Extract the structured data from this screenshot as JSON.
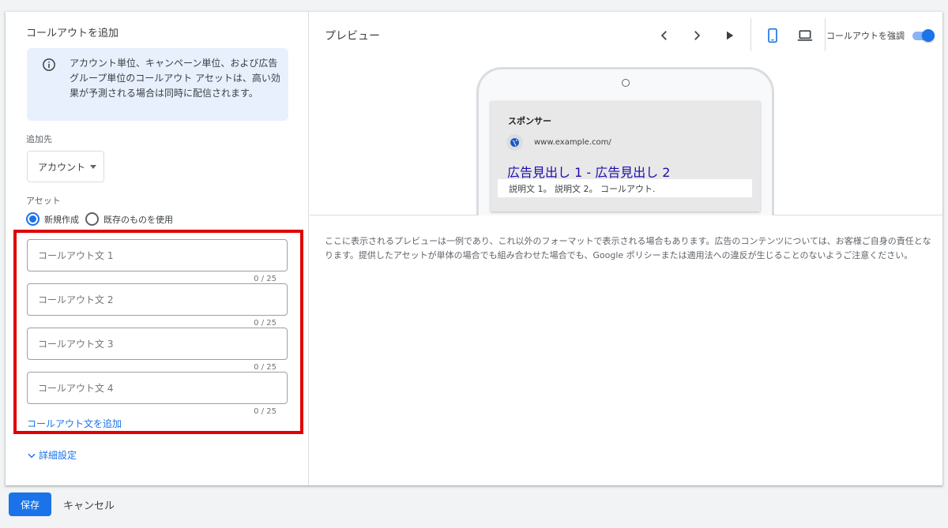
{
  "panel": {
    "title": "コールアウトを追加",
    "info_text": "アカウント単位、キャンペーン単位、および広告グループ単位のコールアウト アセットは、高い効果が予測される場合は同時に配信されます。",
    "add_to_label": "追加先",
    "add_to_value": "アカウント",
    "asset_label": "アセット",
    "radio_new": "新規作成",
    "radio_existing": "既存のものを使用",
    "radio_selected": "新規作成",
    "fields": [
      {
        "placeholder": "コールアウト文 1",
        "value": "",
        "counter": "0 / 25"
      },
      {
        "placeholder": "コールアウト文 2",
        "value": "",
        "counter": "0 / 25"
      },
      {
        "placeholder": "コールアウト文 3",
        "value": "",
        "counter": "0 / 25"
      },
      {
        "placeholder": "コールアウト文 4",
        "value": "",
        "counter": "0 / 25"
      }
    ],
    "add_callout_link": "コールアウト文を追加",
    "advanced_settings": "詳細設定"
  },
  "preview": {
    "title": "プレビュー",
    "toolbar": {
      "prev_icon": "chevron-left-icon",
      "next_icon": "chevron-right-icon",
      "play_icon": "play-icon",
      "mobile_icon": "smartphone-icon",
      "desktop_icon": "laptop-icon",
      "toggle_label": "コールアウトを強調",
      "toggle_on": true
    },
    "ad": {
      "sponsor": "スポンサー",
      "url": "www.example.com/",
      "headline": "広告見出し 1 - 広告見出し 2",
      "description": "説明文 1。 説明文 2。 コールアウト."
    },
    "notice": "ここに表示されるプレビューは一例であり、これ以外のフォーマットで表示される場合もあります。広告のコンテンツについては、お客様ご自身の責任となります。提供したアセットが単体の場合でも組み合わせた場合でも、Google ポリシーまたは適用法への違反が生じることのないようご注意ください。"
  },
  "footer": {
    "save": "保存",
    "cancel": "キャンセル"
  },
  "colors": {
    "accent": "#1a73e8",
    "highlight_border": "#e00000",
    "info_bg": "#e8f0fe"
  }
}
